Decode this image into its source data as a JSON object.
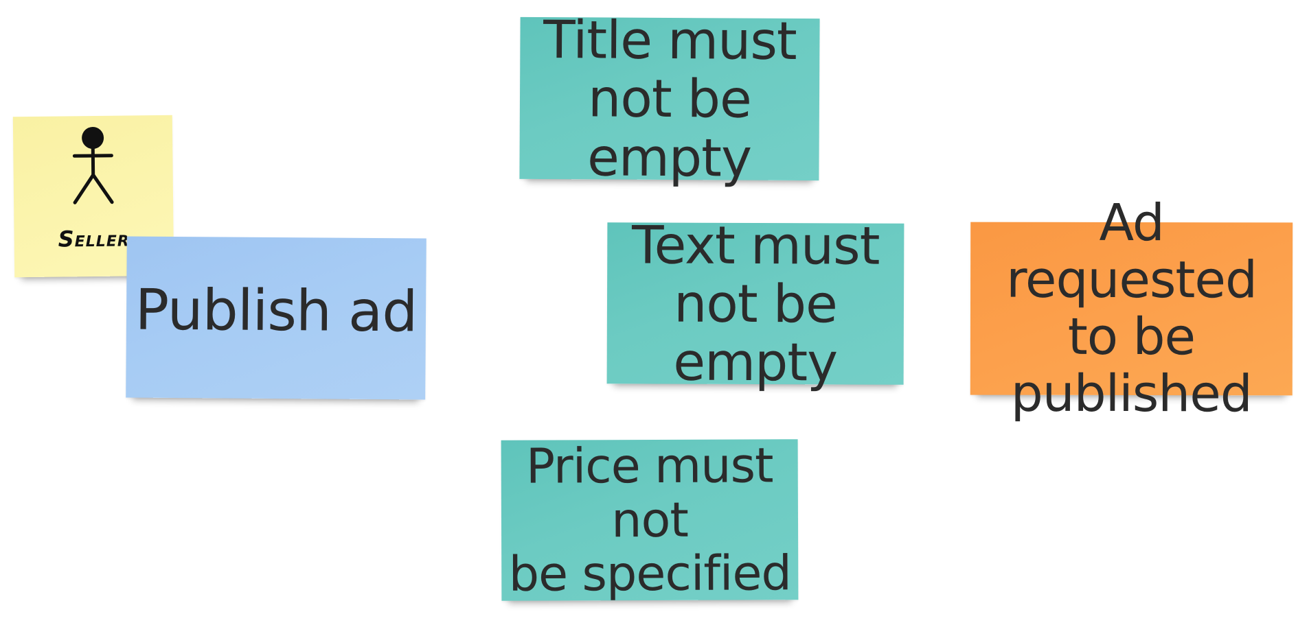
{
  "notes": {
    "title_rule": {
      "text": "Title must\nnot be empty",
      "color": "#6ccbc2"
    },
    "text_rule": {
      "text": "Text must\nnot be empty",
      "color": "#6ccbc2"
    },
    "price_rule": {
      "text": "Price must not\nbe specified",
      "color": "#6ccbc2"
    },
    "command": {
      "text": "Publish ad",
      "color": "#a7ccf4"
    },
    "event": {
      "text": "Ad requested\nto be published",
      "color": "#fca04c"
    },
    "actor": {
      "text": "Seller",
      "icon": "stick-figure-icon",
      "color": "#fbf4ad"
    }
  }
}
